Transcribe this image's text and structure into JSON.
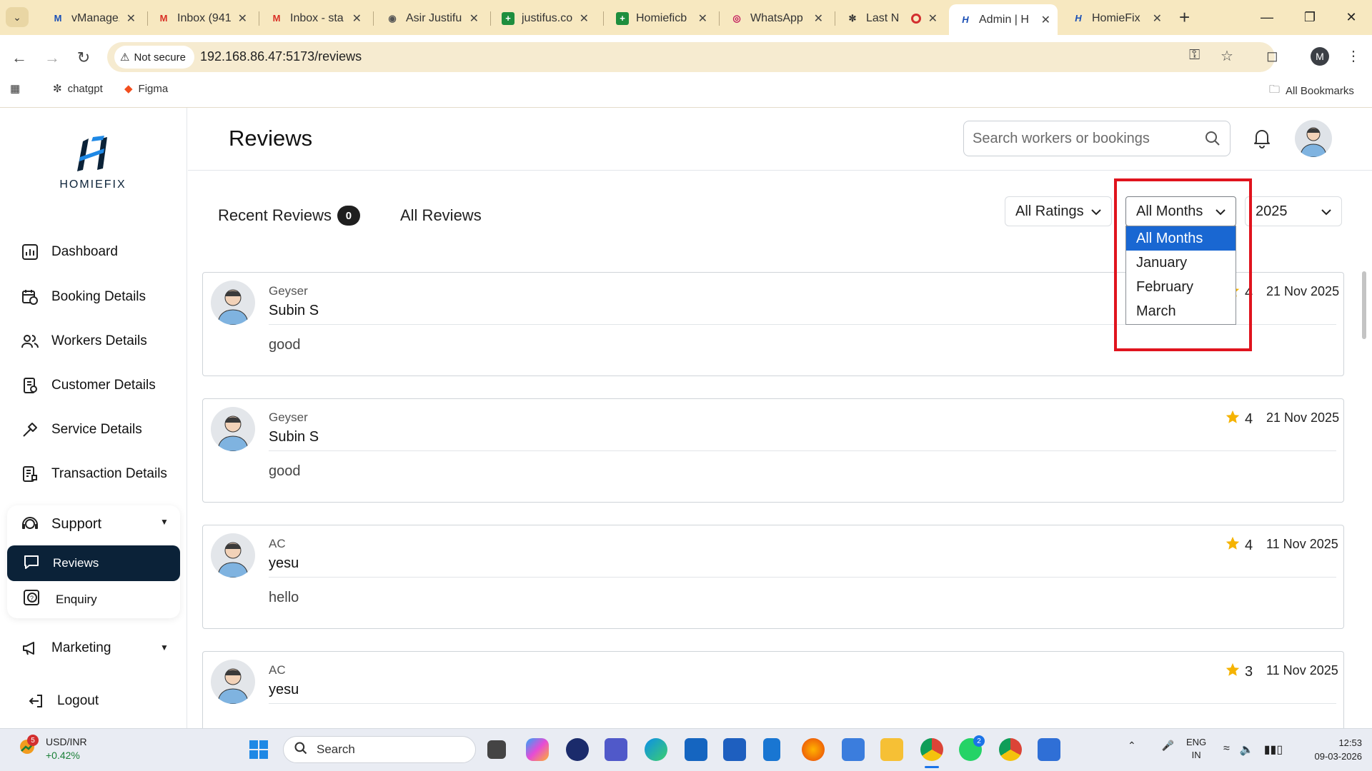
{
  "browser": {
    "tabs": [
      {
        "label": "vManageX",
        "favicon": "vmanagex-icon"
      },
      {
        "label": "Inbox (941",
        "favicon": "gmail-icon"
      },
      {
        "label": "Inbox - sta",
        "favicon": "gmail-icon"
      },
      {
        "label": "Asir Justifu",
        "favicon": "globe-icon"
      },
      {
        "label": "justifus.coi",
        "favicon": "sheets-icon"
      },
      {
        "label": "Homieficb",
        "favicon": "sheets-icon"
      },
      {
        "label": "WhatsApp",
        "favicon": "whatsapp-icon"
      },
      {
        "label": "Last N",
        "favicon": "openai-icon"
      },
      {
        "label": "Admin | H",
        "favicon": "homiefix-icon"
      },
      {
        "label": "HomieFix",
        "favicon": "homiefix-icon"
      }
    ],
    "active_tab": 8,
    "not_secure_label": "Not secure",
    "url": "192.168.86.47:5173/reviews",
    "profile_initial": "M",
    "bookmarks": [
      "chatgpt",
      "Figma"
    ],
    "all_bookmarks_label": "All Bookmarks"
  },
  "sidebar": {
    "logo_text": "HOMIEFIX",
    "items": [
      "Dashboard",
      "Booking Details",
      "Workers Details",
      "Customer Details",
      "Service Details",
      "Transaction Details"
    ],
    "support_label": "Support",
    "support_children": [
      "Reviews",
      "Enquiry"
    ],
    "marketing_label": "Marketing",
    "logout_label": "Logout"
  },
  "header": {
    "title": "Reviews",
    "search_placeholder": "Search workers or bookings"
  },
  "tabs": {
    "recent_label": "Recent Reviews",
    "recent_count": "0",
    "all_label": "All Reviews"
  },
  "filters": {
    "ratings_value": "All Ratings",
    "months_value": "All Months",
    "year_value": "2025",
    "months_options": [
      "All Months",
      "January",
      "February",
      "March"
    ]
  },
  "reviews": [
    {
      "service": "Geyser",
      "name": "Subin S",
      "comment": "good",
      "rating": "4",
      "date": "21 Nov 2025"
    },
    {
      "service": "Geyser",
      "name": "Subin S",
      "comment": "good",
      "rating": "4",
      "date": "21 Nov 2025"
    },
    {
      "service": "AC",
      "name": "yesu",
      "comment": "hello",
      "rating": "4",
      "date": "11 Nov 2025"
    },
    {
      "service": "AC",
      "name": "yesu",
      "comment": "",
      "rating": "3",
      "date": "11 Nov 2025"
    }
  ],
  "taskbar": {
    "weather_badge": "5",
    "ticker": "USD/INR",
    "ticker_delta": "+0.42%",
    "search_label": "Search",
    "teams_badge": "2",
    "lang_top": "ENG",
    "lang_bottom": "IN",
    "time": "12:53",
    "date": "09-03-2026"
  },
  "colors": {
    "sidebar_active_bg": "#0b2238",
    "dropdown_selected": "#1967d2",
    "highlight_box": "#e0141e",
    "star": "#f5b301"
  }
}
